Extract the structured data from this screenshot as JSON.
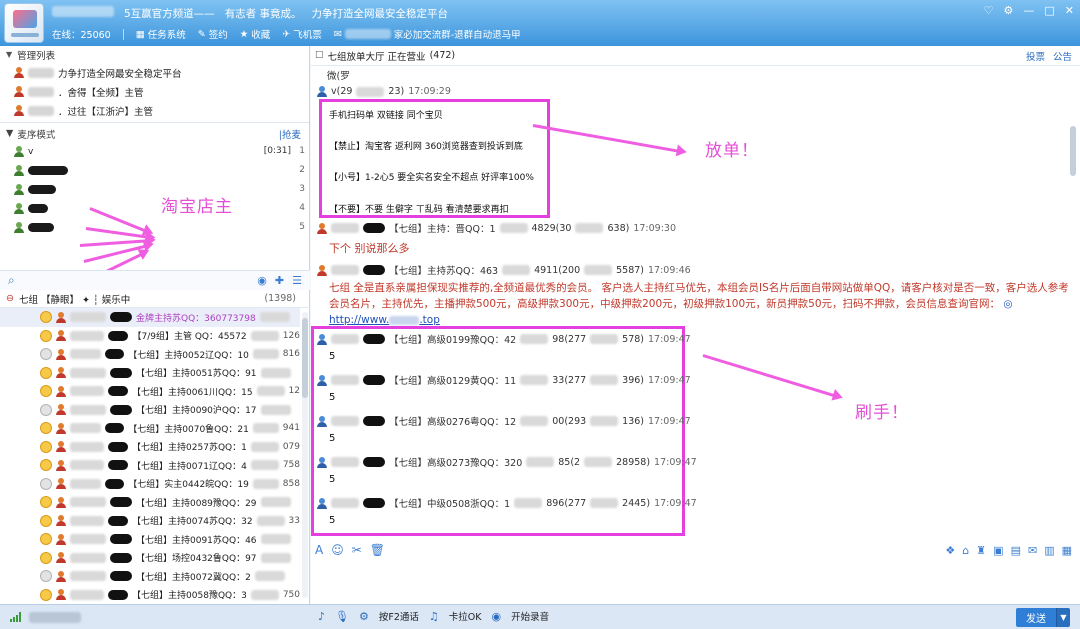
{
  "titlebar": {
    "channel_name": "5互赢官方频道——",
    "slogan": "有志者 事竟成。",
    "platform": "力争打造全网最安全稳定平台",
    "online_label": "在线：25060",
    "nav": [
      "任务系统",
      "签约",
      "收藏",
      "飞机票"
    ],
    "notice": "家必加交流群-退群自动退马甲"
  },
  "admin": {
    "header": "管理列表",
    "rows": [
      "力争打造全网最安全稳定平台",
      "．舍得【全频】主管",
      "．过往【江浙沪】主管"
    ]
  },
  "queue": {
    "header": "麦序模式",
    "grab": "|抢麦",
    "first_name": "v",
    "first_time": "[0:31]",
    "numbers": [
      "1",
      "2",
      "3",
      "4",
      "5"
    ]
  },
  "left_annotation": "淘宝店主",
  "group": {
    "name": "七组 【静眼】 ✦ ┆ 娱乐中",
    "count": "(1398)"
  },
  "members": [
    "金牌主持苏QQ：360773798",
    "【7/9组】主管 QQ：45572",
    "【七组】主持0052辽QQ：10",
    "【七组】主持0051苏QQ：91",
    "【七组】主持0061川QQ：15",
    "【七组】主持0090沪QQ：17",
    "【七组】主持0070鲁QQ：21",
    "【七组】主持0257苏QQ：1",
    "【七组】主持0071辽QQ：4",
    "【七组】实主0442皖QQ：19",
    "【七组】主持0089豫QQ：29",
    "【七组】主持0074苏QQ：32",
    "【七组】主持0091苏QQ：46",
    "【七组】场控0432鲁QQ：97",
    "【七组】主持0072冀QQ：2",
    "【七组】主持0058豫QQ：3"
  ],
  "member_extras": [
    "126",
    "816",
    "12",
    "941",
    "079",
    "758",
    "858",
    "33",
    "750"
  ],
  "room": {
    "title": "七组放单大厅 正在营业",
    "count": "(472)",
    "links": [
      "投票",
      "公告"
    ]
  },
  "chat": {
    "top_text": "微(罗",
    "user1": "v(29",
    "user1_tail": "23)",
    "time1": "17:09:29",
    "order": {
      "line1": "手机扫码单 双链接 同个宝贝",
      "line2": "【禁止】淘宝客 返利网 360浏览器查到投诉到底",
      "line3": "【小号】1-2心5 要全实名安全不超点 好评率100%",
      "line4": "【不要】不要 生僻字 ㄒ乱码 看清楚要求再扣"
    },
    "msg2_role": "【七组】主持：晋QQ：1",
    "msg2_qq": "4829(30",
    "msg2_tail": "638)",
    "time2": "17:09:30",
    "red_msg": "下个 别说那么多",
    "msg3_role": "【七组】主持苏QQ：463",
    "msg3_qq": "4911(200",
    "msg3_tail": "5587)",
    "time3": "17:09:46",
    "long_msg": "七组 全是直系亲属担保现实推荐的,全频道最优秀的会员。 客户选人主持红马优先，本组会员IS名片后面自带网站做单QQ，请客户核对是否一致，客户选人参考会员名片，主持优先，主播押款500元，高级押款300元，中级押款200元，初级押款100元，新员押款50元，扫码不押款，会员信息查询官网：",
    "url": "http://www.",
    "url_tail": ".top",
    "replies": [
      {
        "role": "【七组】高级0199豫QQ：42",
        "qq": "98(277",
        "tail": "578)",
        "time": "17:09:47"
      },
      {
        "role": "【七组】高级0129黄QQ：11",
        "qq": "33(277",
        "tail": "396)",
        "time": "17:09:47"
      },
      {
        "role": "【七组】高级0276粤QQ：12",
        "qq": "00(293",
        "tail": "136)",
        "time": "17:09:47"
      },
      {
        "role": "【七组】高级0273豫QQ：320",
        "qq": "85(2",
        "tail": "28958)",
        "time": "17:09:47"
      },
      {
        "role": "【七组】中级0508浙QQ：1",
        "qq": "896(277",
        "tail": "2445)",
        "time": "17:09:47"
      }
    ],
    "reply_text": "5"
  },
  "annotations": {
    "order": "放单！",
    "brush": "刷手！"
  },
  "bottom": {
    "f2": "按F2通话",
    "karaoke": "卡拉OK",
    "record": "开始录音",
    "send": "发送"
  },
  "colors": {
    "accent": "#3d95dc",
    "annotation": "#e63fe0",
    "message_red": "#c0392b"
  }
}
